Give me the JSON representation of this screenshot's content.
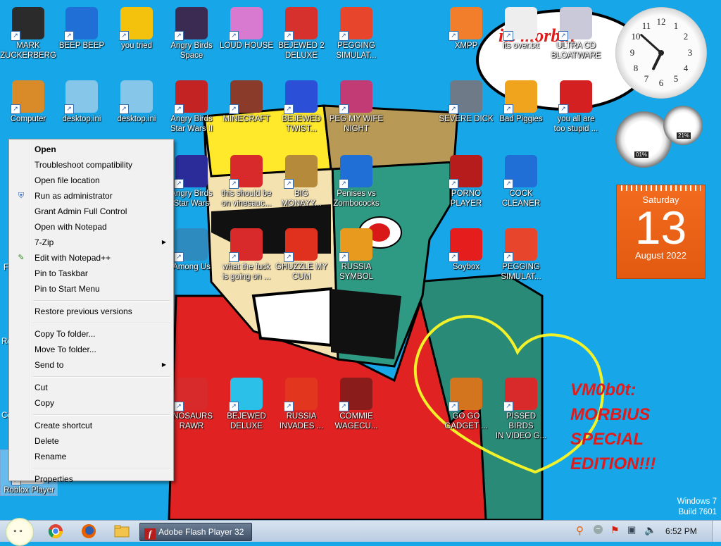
{
  "desktop": {
    "icons": [
      {
        "label": "MARK\nZUCKERBERG",
        "icon": "person-file-icon",
        "color": "#2b2b2b"
      },
      {
        "label": "BEEP BEEP",
        "icon": "blue-book-icon",
        "color": "#1f6fd6"
      },
      {
        "label": "you tried",
        "icon": "gold-star-icon",
        "color": "#f4c20d"
      },
      {
        "label": "Angry Birds\nSpace",
        "icon": "angry-birds-space-icon",
        "color": "#3b2b52"
      },
      {
        "label": "LOUD HOUSE",
        "icon": "loud-house-icon",
        "color": "#d77ad0"
      },
      {
        "label": "BEJEWED 2\nDELUXE",
        "icon": "bejeweled-2-icon",
        "color": "#d6312c"
      },
      {
        "label": "PEGGING\nSIMULAT...",
        "icon": "pegging-simulator-icon",
        "color": "#e8462c"
      },
      {
        "label": "XMPP",
        "icon": "xampp-icon",
        "color": "#f27d2a"
      },
      {
        "label": "its over.txt",
        "icon": "text-file-icon",
        "color": "#eeeeee"
      },
      {
        "label": "ULTRA CD\nBLOATWARE",
        "icon": "cd-icon",
        "color": "#c9c9d9"
      },
      {
        "label": "Computer",
        "icon": "computer-icon",
        "color": "#d98b2a"
      },
      {
        "label": "desktop.ini",
        "icon": "settings-file-icon",
        "color": "#86c6e8"
      },
      {
        "label": "desktop.ini",
        "icon": "settings-file-icon",
        "color": "#86c6e8"
      },
      {
        "label": "Angry Birds\nStar Wars II",
        "icon": "angry-birds-star-wars-2-icon",
        "color": "#c32323"
      },
      {
        "label": "MINECRAFT",
        "icon": "minecraft-icon",
        "color": "#8a3b2a"
      },
      {
        "label": "BEJEWED\nTWIST...",
        "icon": "bejeweled-twist-icon",
        "color": "#2b4fd6"
      },
      {
        "label": "PEG MY WIFE\nNIGHT",
        "icon": "peg-night-icon",
        "color": "#c23b74"
      },
      {
        "label": "SEVERE DICK",
        "icon": "sd-gear-icon",
        "color": "#6e7a87"
      },
      {
        "label": "Bad Piggies",
        "icon": "bad-piggies-icon",
        "color": "#f0a41e"
      },
      {
        "label": "you all are\ntoo stupid ...",
        "icon": "dev-cpp-icon",
        "color": "#d42020"
      },
      {
        "label": "Angry Birds\nStar Wars",
        "icon": "angry-birds-star-wars-icon",
        "color": "#2b2b9a"
      },
      {
        "label": "this should be\non vinesauc...",
        "icon": "red-bird-icon",
        "color": "#d82a2a"
      },
      {
        "label": "BIG\nMONAYY...",
        "icon": "money-bag-icon",
        "color": "#b58a3a"
      },
      {
        "label": "Penises vs\nZombococks",
        "icon": "blue-book-icon",
        "color": "#1f6fd6"
      },
      {
        "label": "PORNO\nPLAYER",
        "icon": "flash-icon",
        "color": "#b71c1c"
      },
      {
        "label": "COCK\nCLEANER",
        "icon": "blue-book-icon",
        "color": "#1f6fd6"
      },
      {
        "label": "Among Us",
        "icon": "among-us-icon",
        "color": "#2e8bc0"
      },
      {
        "label": "what the fuck\nis going on ...",
        "icon": "red-bird-icon",
        "color": "#d82a2a"
      },
      {
        "label": "GHUZZLE MY\nCUM",
        "icon": "red-fuzzball-icon",
        "color": "#e0301e"
      },
      {
        "label": "RUSSIA\nSYMBOL",
        "icon": "russia-symbol-icon",
        "color": "#e89a1e"
      },
      {
        "label": "Soybox",
        "icon": "soybox-icon",
        "color": "#e51d1d"
      },
      {
        "label": "PEGGING\nSIMULAT...",
        "icon": "pegging-simulator-icon",
        "color": "#e8462c"
      },
      {
        "label": "INOSAURS\nRAWR",
        "icon": "red-bird-icon",
        "color": "#d82a2a"
      },
      {
        "label": "BEJEWED\nDELUXE",
        "icon": "diamond-icon",
        "color": "#2bc0e8"
      },
      {
        "label": "RUSSIA\nINVADES ...",
        "icon": "radiation-icon",
        "color": "#e2361e"
      },
      {
        "label": "COMMIE\nWAGECU...",
        "icon": "commie-icon",
        "color": "#8a1c1c"
      },
      {
        "label": "GO GO\nGADGET ...",
        "icon": "briefcase-icon",
        "color": "#d2751e"
      },
      {
        "label": "PISSED BIRDS\nIN VIDEO G...",
        "icon": "red-bird-icon",
        "color": "#d82a2a"
      },
      {
        "label": "Roblox Player",
        "icon": "roblox-icon",
        "color": "#e8e8e8"
      }
    ],
    "partial_labels": [
      "Ro",
      "Co",
      "F"
    ],
    "wall_text": {
      "bubble": "its morbin",
      "caption": "VM0b0t:\nMORBIUS\nSPECIAL\nEDITION!!!"
    },
    "watermark": {
      "line1": "Windows 7",
      "line2": "Build 7601"
    }
  },
  "context_menu": {
    "items": [
      {
        "label": "Open",
        "bold": true
      },
      {
        "label": "Troubleshoot compatibility"
      },
      {
        "label": "Open file location"
      },
      {
        "label": "Run as administrator",
        "icon": "uac-shield-icon"
      },
      {
        "label": "Grant Admin Full Control"
      },
      {
        "label": "Open with Notepad"
      },
      {
        "label": "7-Zip",
        "submenu": true
      },
      {
        "label": "Edit with Notepad++",
        "icon": "notepad-plus-icon"
      },
      {
        "label": "Pin to Taskbar"
      },
      {
        "label": "Pin to Start Menu"
      },
      {
        "sep": true
      },
      {
        "label": "Restore previous versions"
      },
      {
        "sep": true
      },
      {
        "label": "Copy To folder..."
      },
      {
        "label": "Move To folder..."
      },
      {
        "label": "Send to",
        "submenu": true
      },
      {
        "sep": true
      },
      {
        "label": "Cut"
      },
      {
        "label": "Copy"
      },
      {
        "sep": true
      },
      {
        "label": "Create shortcut"
      },
      {
        "label": "Delete"
      },
      {
        "label": "Rename"
      },
      {
        "sep": true
      },
      {
        "label": "Properties"
      }
    ],
    "submenu_glyph": "▶"
  },
  "gadgets": {
    "calendar": {
      "weekday": "Saturday",
      "day": "13",
      "month_year": "August 2022"
    },
    "clock": {
      "hour": 6,
      "minute": 52
    },
    "cpu_meter": {
      "cpu": "01%",
      "memory": "21%"
    }
  },
  "taskbar": {
    "start_icon": "start-orb-icon",
    "pinned": [
      "chrome-icon",
      "firefox-icon",
      "folder-icon"
    ],
    "active_window": {
      "icon": "flash-icon",
      "label": "Adobe Flash Player 32"
    },
    "tray_icons": [
      "search-tray-icon",
      "minus-tray-icon",
      "flag-tray-icon",
      "network-tray-icon",
      "volume-icon"
    ],
    "time": "6:52 PM"
  }
}
